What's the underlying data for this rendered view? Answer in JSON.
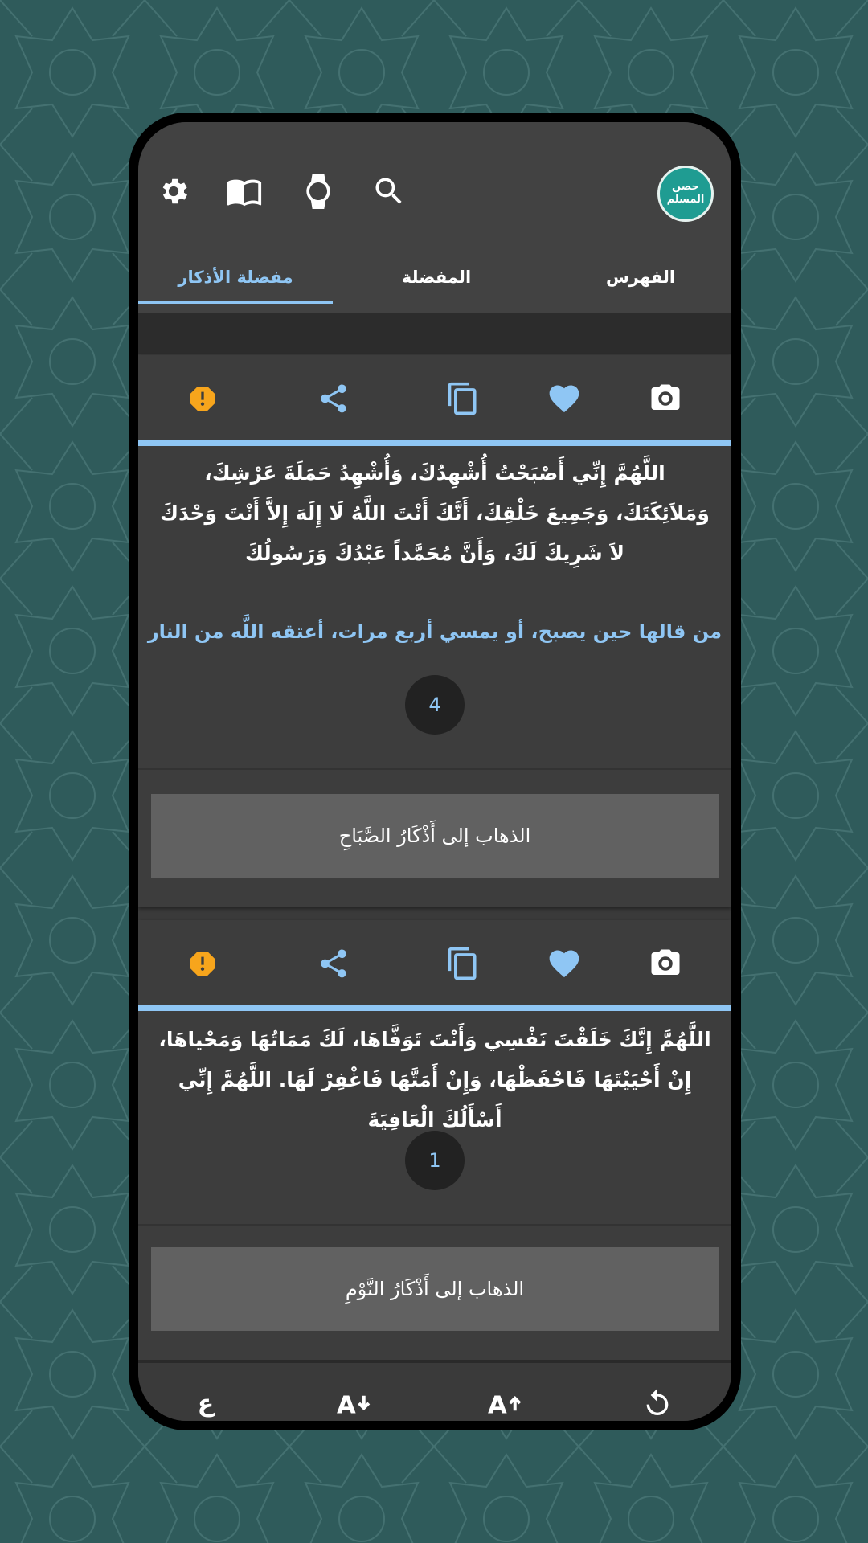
{
  "app": {
    "logo_text_top": "حصن",
    "logo_text_bottom": "المسلم"
  },
  "toolbar_icons": [
    "settings-icon",
    "book-icon",
    "watch-icon",
    "search-icon"
  ],
  "tabs": [
    {
      "label": "الفهرس",
      "active": false
    },
    {
      "label": "المفضلة",
      "active": false
    },
    {
      "label": "مفضلة الأذكار",
      "active": true
    }
  ],
  "cards": [
    {
      "text": "اللَّهُمَّ إِنِّي أَصْبَحْتُ أُشْهِدُكَ، وَأُشْهِدُ حَمَلَةَ عَرْشِكَ، وَمَلاَئِكَتَكَ، وَجَمِيعَ خَلْقِكَ، أَنَّكَ أَنْتَ اللَّهُ لَا إِلَهَ إِلاَّ أَنْتَ وَحْدَكَ لاَ شَرِيكَ لَكَ، وَأَنَّ مُحَمَّداً عَبْدُكَ وَرَسُولُكَ",
      "virtue": "من قالها حين يصبح، أو يمسي أربع مرات، أعتقه اللَّه من النار",
      "count": "4",
      "goto_label": "الذهاب إلى أَذْكَارُ الصَّبَاحِ"
    },
    {
      "text": "اللَّهُمَّ إِنَّكَ خَلَقْتَ نَفْسِي وَأَنْتَ تَوَفَّاهَا، لَكَ مَمَاتُهَا وَمَحْياهَا، إِنْ أَحْيَيْتَهَا فَاحْفَظْهَا، وَإِنْ أَمَتَّهَا فَاغْفِرْ لَهَا. اللَّهُمَّ  إِنِّي أَسْأَلُكَ الْعَافِيَةَ",
      "count": "1",
      "goto_label": "الذهاب إلى أَذْكَارُ النَّوْمِ"
    }
  ],
  "card_actions": [
    "report-icon",
    "share-icon",
    "copy-icon",
    "favorite-icon",
    "camera-icon"
  ],
  "bottom_bar": {
    "arabic_toggle": "ع"
  },
  "colors": {
    "accent": "#8fc6f4",
    "warning": "#f7a51c",
    "background": "#2f5b5b",
    "card": "#3d3d3d"
  }
}
